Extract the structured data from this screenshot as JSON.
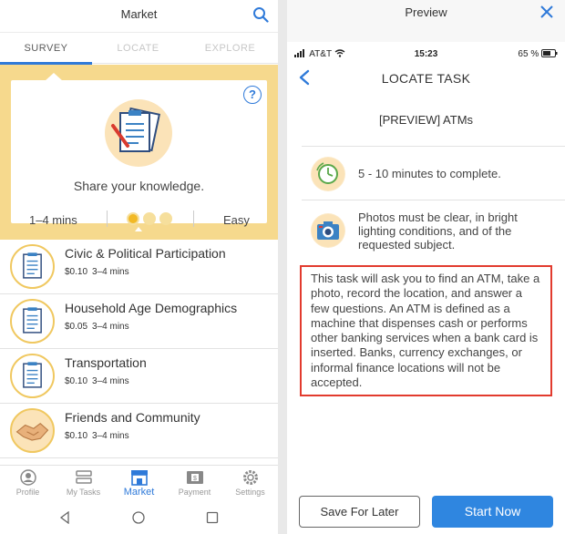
{
  "left": {
    "header": {
      "title": "Market",
      "search_icon": "search-icon"
    },
    "tabs": [
      {
        "label": "SURVEY",
        "active": true
      },
      {
        "label": "LOCATE",
        "active": false
      },
      {
        "label": "EXPLORE",
        "active": false
      }
    ],
    "banner": {
      "text": "Share your knowledge.",
      "time": "1–4 mins",
      "difficulty": "Easy",
      "difficulty_level": 1,
      "difficulty_max": 3,
      "colors": {
        "background": "#f6d98d",
        "dot_filled": "#f2b925",
        "dot_empty": "#f6df9c"
      }
    },
    "list": [
      {
        "title": "Civic & Political Participation",
        "price": "$0.10",
        "time": "3–4 mins",
        "icon": "survey-clipboard-icon"
      },
      {
        "title": "Household Age Demographics",
        "price": "$0.05",
        "time": "3–4 mins",
        "icon": "survey-clipboard-icon"
      },
      {
        "title": "Transportation",
        "price": "$0.10",
        "time": "3–4 mins",
        "icon": "survey-clipboard-icon"
      },
      {
        "title": "Friends and Community",
        "price": "$0.10",
        "time": "3–4 mins",
        "icon": "handshake-icon"
      }
    ],
    "bottom_nav": [
      {
        "label": "Profile",
        "icon": "profile-icon",
        "active": false
      },
      {
        "label": "My Tasks",
        "icon": "tasks-icon",
        "active": false
      },
      {
        "label": "Market",
        "icon": "market-icon",
        "active": true
      },
      {
        "label": "Payment",
        "icon": "payment-icon",
        "active": false
      },
      {
        "label": "Settings",
        "icon": "settings-icon",
        "active": false
      }
    ]
  },
  "right": {
    "header": {
      "title": "Preview",
      "close_icon": "close-icon"
    },
    "status_bar": {
      "carrier": "AT&T",
      "time": "15:23",
      "battery": "65 %"
    },
    "nav": {
      "title": "LOCATE TASK",
      "back_icon": "back-chevron-icon"
    },
    "task_name": "[PREVIEW] ATMs",
    "info": [
      {
        "icon": "clock-icon",
        "text": "5 - 10 minutes to complete."
      },
      {
        "icon": "camera-icon",
        "text": "Photos must be clear, in bright lighting conditions, and of the requested subject."
      }
    ],
    "description": "This task will ask you to find an ATM, take a photo, record the location, and answer a few questions. An ATM is defined as a machine that dispenses cash or performs other banking services when a bank card is inserted. Banks, currency exchanges, or informal finance locations will not be accepted.",
    "buttons": {
      "later": "Save For Later",
      "start": "Start Now"
    },
    "colors": {
      "accent": "#2f86e0",
      "highlight_border": "#e23b2e"
    }
  }
}
